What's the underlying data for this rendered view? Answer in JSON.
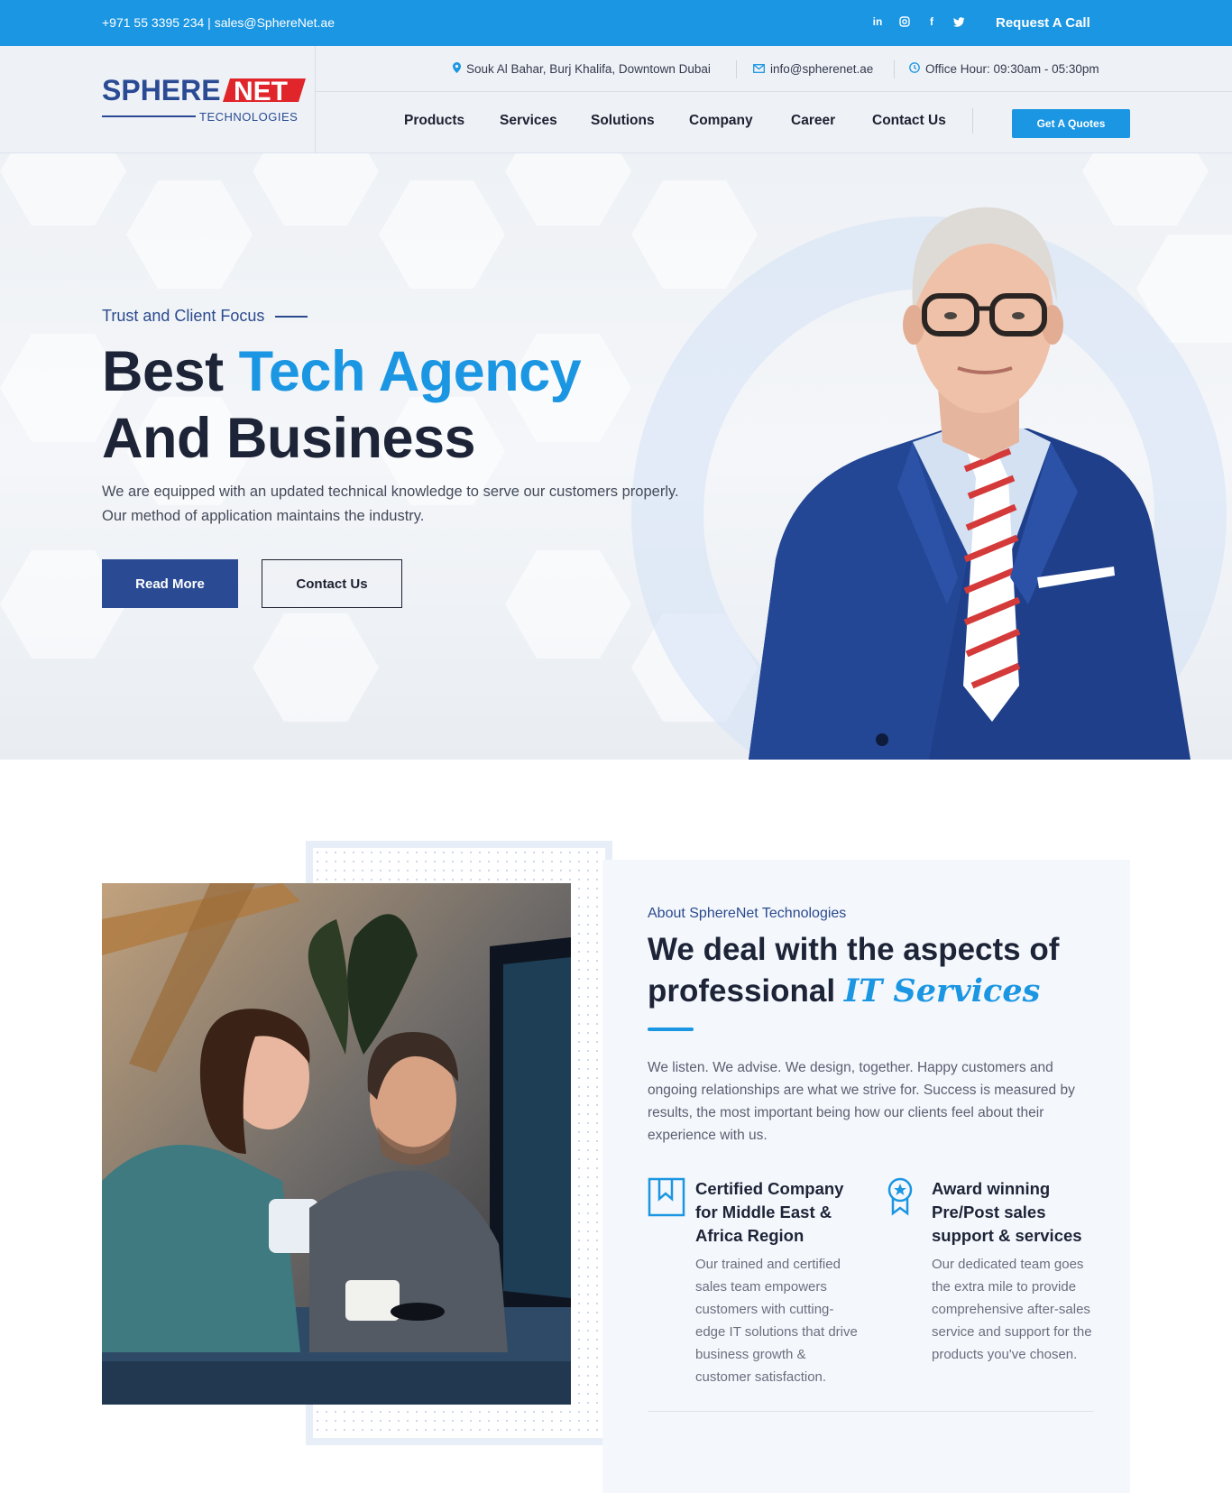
{
  "topbar": {
    "contact": "+971 55 3395 234 | sales@SphereNet.ae",
    "social": [
      "linkedin-icon",
      "instagram-icon",
      "facebook-icon",
      "twitter-icon"
    ],
    "request_call": "Request A Call"
  },
  "logo": {
    "sphere": "SPHERE",
    "net": "NET",
    "tagline": "TECHNOLOGIES"
  },
  "info": {
    "address": "Souk Al Bahar, Burj Khalifa, Downtown Dubai",
    "email": "info@spherenet.ae",
    "hours": "Office Hour: 09:30am - 05:30pm"
  },
  "nav": {
    "items": [
      "Products",
      "Services",
      "Solutions",
      "Company",
      "Career",
      "Contact Us"
    ],
    "quote": "Get A Quotes"
  },
  "hero": {
    "eyebrow": "Trust and Client Focus",
    "title_part1": "Best ",
    "title_accent": "Tech Agency",
    "title_part2": "And Business",
    "text": "We are equipped with an updated technical knowledge to serve our customers properly. Our method of application maintains the industry.",
    "read_more": "Read More",
    "contact": "Contact Us"
  },
  "about": {
    "eyebrow": "About SphereNet Technologies",
    "title_line1": "We deal with the aspects of",
    "title_line2": "professional ",
    "title_script": "IT Services",
    "text": "We listen. We advise. We design, together. Happy customers and ongoing relationships are what we strive for. Success is measured by results, the most important being how our clients feel about their experience with us.",
    "features": [
      {
        "icon": "bookmark-icon",
        "title": "Certified Company for Middle East & Africa Region",
        "text": "Our trained and certified sales team empowers customers with cutting-edge IT solutions that drive business growth & customer satisfaction."
      },
      {
        "icon": "award-icon",
        "title": "Award winning Pre/Post sales support & services",
        "text": "Our dedicated team goes the extra mile to provide comprehensive after-sales service and support for the products you've chosen."
      }
    ]
  },
  "colors": {
    "primary": "#1b96e2",
    "navy": "#2a4b94",
    "logo_red": "#e0262b",
    "logo_blue": "#2a4b94"
  }
}
